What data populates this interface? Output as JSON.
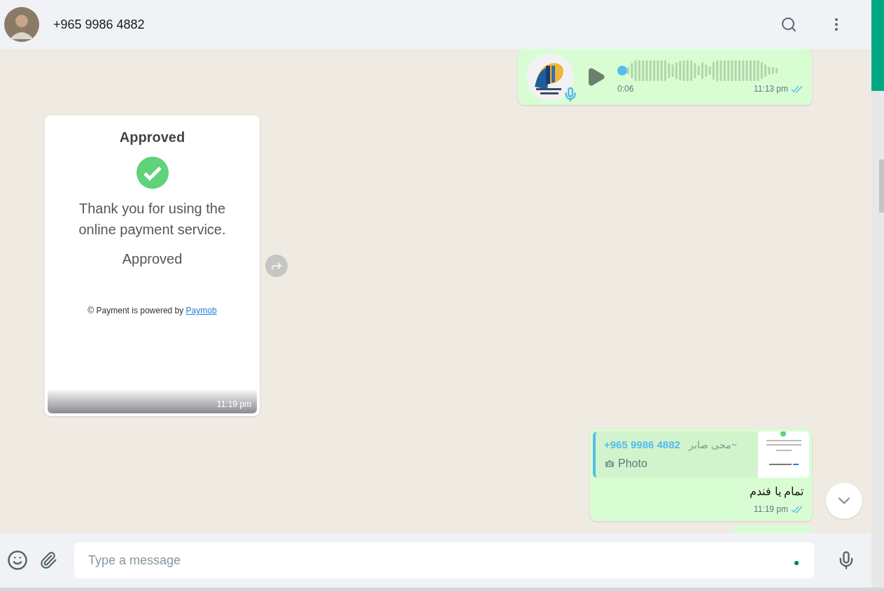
{
  "header": {
    "contact": "+965 9986 4882"
  },
  "messages": [
    {
      "kind": "voice",
      "duration": "0:06",
      "time": "11:13 pm",
      "read": true
    },
    {
      "card": {
        "title": "Approved",
        "message": "Thank you for using the online payment service.",
        "status": "Approved",
        "footer": "© Payment is powered by",
        "link": "Paymob"
      },
      "time": "11:19 pm"
    },
    {
      "kind": "reply",
      "quote": {
        "sender": "+965 9986 4882",
        "name": "~محى صابر",
        "media": "Photo"
      },
      "text": "تمام يا فندم",
      "time": "11:19 pm",
      "read": true
    },
    {
      "kind": "partial"
    }
  ],
  "composer": {
    "placeholder": "Type a message"
  }
}
